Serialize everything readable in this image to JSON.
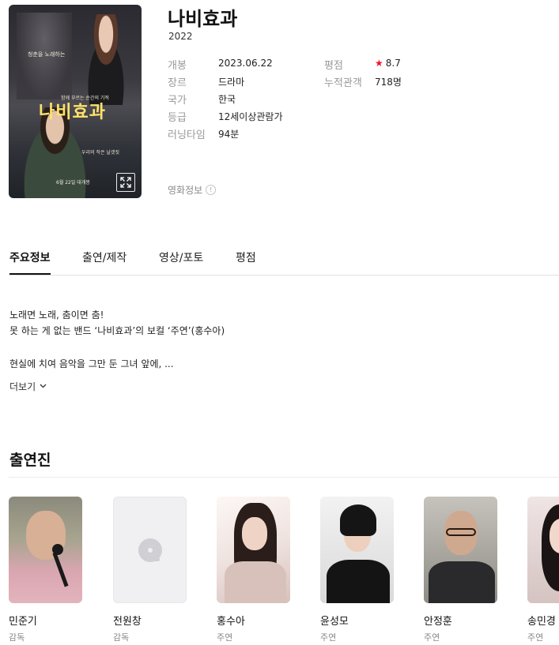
{
  "movie": {
    "title": "나비효과",
    "year": "2022",
    "poster": {
      "tagline": "청춘을 노래하는",
      "tagline2": "함께 부르는 순간의 기적",
      "title": "나비효과",
      "sub": "우리의 작은 날갯짓",
      "date": "6월 22일 대개봉",
      "expand_icon": "expand-icon"
    },
    "info": {
      "release_label": "개봉",
      "release_value": "2023.06.22",
      "genre_label": "장르",
      "genre_value": "드라마",
      "country_label": "국가",
      "country_value": "한국",
      "grade_label": "등급",
      "grade_value": "12세이상관람가",
      "runtime_label": "러닝타임",
      "runtime_value": "94분",
      "rating_label": "평점",
      "rating_value": "8.7",
      "audience_label": "누적관객",
      "audience_value": "718명"
    },
    "info_link": "영화정보",
    "star_color": "#f0122d"
  },
  "tabs": [
    {
      "label": "주요정보"
    },
    {
      "label": "출연/제작"
    },
    {
      "label": "영상/포토"
    },
    {
      "label": "평점"
    }
  ],
  "synopsis": {
    "line1": "노래면 노래, 춤이면 춤!",
    "line2": "못 하는 게 없는 밴드 ‘나비효과’의 보컬 ‘주연’(홍수아)",
    "line3": "현실에 치여 음악을 그만 둔 그녀 앞에, ...",
    "more_label": "더보기"
  },
  "cast": {
    "heading": "출연진",
    "people": [
      {
        "name": "민준기",
        "role": "감독"
      },
      {
        "name": "전원창",
        "role": "감독"
      },
      {
        "name": "홍수아",
        "role": "주연"
      },
      {
        "name": "윤성모",
        "role": "주연"
      },
      {
        "name": "안정훈",
        "role": "주연"
      },
      {
        "name": "송민경",
        "role": "주연"
      }
    ]
  }
}
